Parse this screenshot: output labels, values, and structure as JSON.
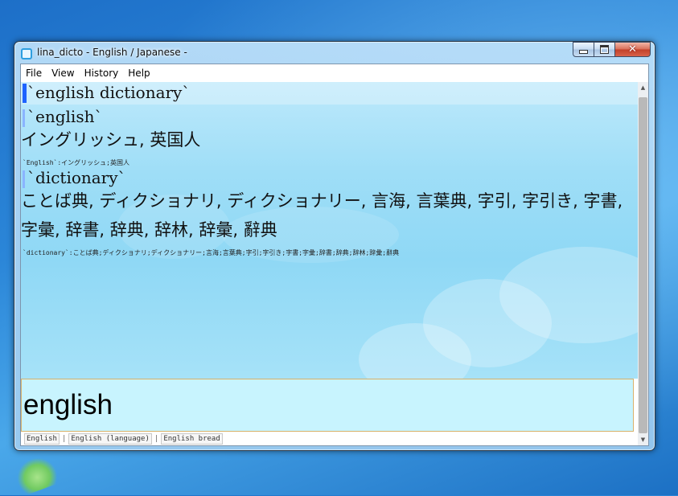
{
  "window": {
    "title": "lina_dicto - English / Japanese -",
    "close_glyph": "✕"
  },
  "menu": [
    "File",
    "View",
    "History",
    "Help"
  ],
  "content": {
    "heading": "`english dictionary`",
    "entries": [
      {
        "word": "`english`",
        "translation": "イングリッシュ, 英国人",
        "raw": "`English`:イングリッシュ;英国人"
      },
      {
        "word": "`dictionary`",
        "translation": "ことば典, ディクショナリ, ディクショナリー, 言海, 言葉典, 字引, 字引き, 字書, 字彙, 辞書, 辞典, 辞林, 辞彙, 辭典",
        "raw": "`dictionary`:ことば典;ディクショナリ;ディクショナリー;言海;言葉典;字引;字引き;字書;字彙;辞書;辞典;辞林;辞彙;辭典"
      }
    ]
  },
  "input": {
    "value": "english"
  },
  "suggestions": [
    "English",
    "English (language)",
    "English bread"
  ],
  "scrollbar": {
    "up_glyph": "▲",
    "down_glyph": "▼"
  },
  "colors": {
    "accent": "#1e63ff",
    "content_bg": "#9fdef7",
    "input_bg": "#c8f4fe"
  }
}
